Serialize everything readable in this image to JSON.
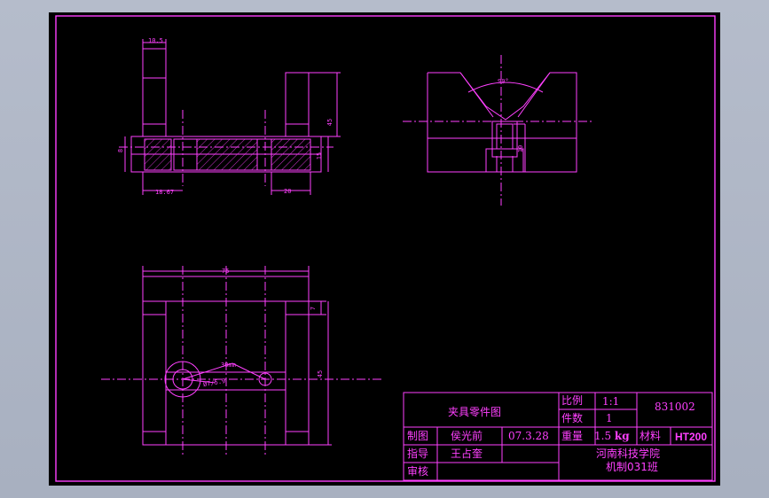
{
  "drawing": {
    "dimensions": {
      "top_width": "10.5",
      "right_height": "45",
      "left_small": "8",
      "right_small": "15",
      "bottom_left": "18.67",
      "bottom_right": "20",
      "vee_angle": "90°",
      "vee_right": "10",
      "plan_width": "75",
      "plan_small": "7",
      "plan_height": "45",
      "center_dist": "30mm",
      "hole_dim": "Ø7/5.9"
    }
  },
  "title_block": {
    "part_name": "夹具零件图",
    "scale_label": "比例",
    "scale_value": "1:1",
    "count_label": "件数",
    "count_value": "1",
    "drawing_number": "831002",
    "drafted_label": "制图",
    "drafted_by": "侯光前",
    "date": "07.3.28",
    "weight_label": "重量",
    "weight_value": "1.5",
    "weight_unit": "kg",
    "material_label": "材料",
    "material_value": "HT200",
    "guide_label": "指导",
    "guide_name": "王占奎",
    "review_label": "审核",
    "school": "河南科技学院",
    "class_name": "机制031班"
  }
}
